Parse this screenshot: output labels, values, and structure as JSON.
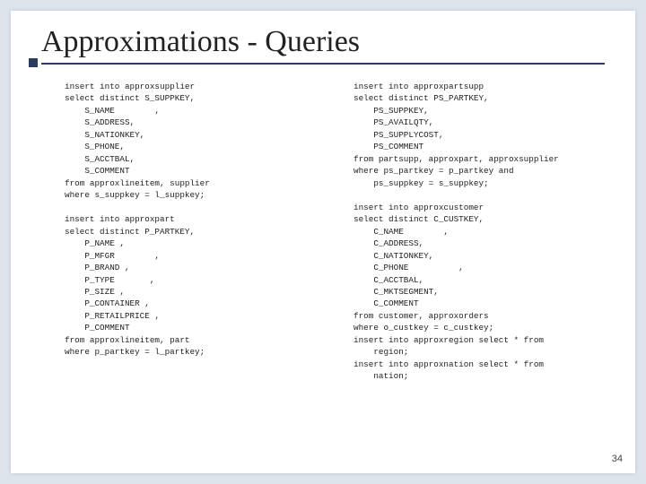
{
  "title": "Approximations - Queries",
  "page_number": "34",
  "left_block": "insert into approxsupplier\nselect distinct S_SUPPKEY,\n    S_NAME        ,\n    S_ADDRESS,\n    S_NATIONKEY,\n    S_PHONE,\n    S_ACCTBAL,\n    S_COMMENT\nfrom approxlineitem, supplier\nwhere s_suppkey = l_suppkey;\n\ninsert into approxpart\nselect distinct P_PARTKEY,\n    P_NAME ,\n    P_MFGR        ,\n    P_BRAND ,\n    P_TYPE       ,\n    P_SIZE ,\n    P_CONTAINER ,\n    P_RETAILPRICE ,\n    P_COMMENT\nfrom approxlineitem, part\nwhere p_partkey = l_partkey;",
  "right_block": "insert into approxpartsupp\nselect distinct PS_PARTKEY,\n    PS_SUPPKEY,\n    PS_AVAILQTY,\n    PS_SUPPLYCOST,\n    PS_COMMENT\nfrom partsupp, approxpart, approxsupplier\nwhere ps_partkey = p_partkey and\n    ps_suppkey = s_suppkey;\n\ninsert into approxcustomer\nselect distinct C_CUSTKEY,\n    C_NAME        ,\n    C_ADDRESS,\n    C_NATIONKEY,\n    C_PHONE          ,\n    C_ACCTBAL,\n    C_MKTSEGMENT,\n    C_COMMENT\nfrom customer, approxorders\nwhere o_custkey = c_custkey;\ninsert into approxregion select * from\n    region;\ninsert into approxnation select * from\n    nation;"
}
